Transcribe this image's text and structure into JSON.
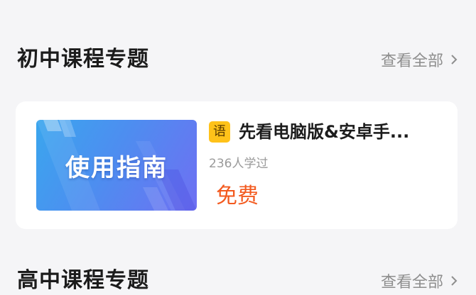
{
  "sections": [
    {
      "title": "初中课程专题",
      "see_all_label": "查看全部"
    },
    {
      "title": "高中课程专题",
      "see_all_label": "查看全部"
    }
  ],
  "course": {
    "thumbnail_text": "使用指南",
    "subject_badge": "语",
    "title": "先看电脑版&安卓手...",
    "learners": "236人学过",
    "price": "免费"
  },
  "colors": {
    "background": "#f5f5f7",
    "card": "#ffffff",
    "badge": "#ffc21a",
    "price": "#f35a1f",
    "muted_text": "#9a9a9a"
  },
  "icons": {
    "see_all": "chevron-right-icon"
  }
}
